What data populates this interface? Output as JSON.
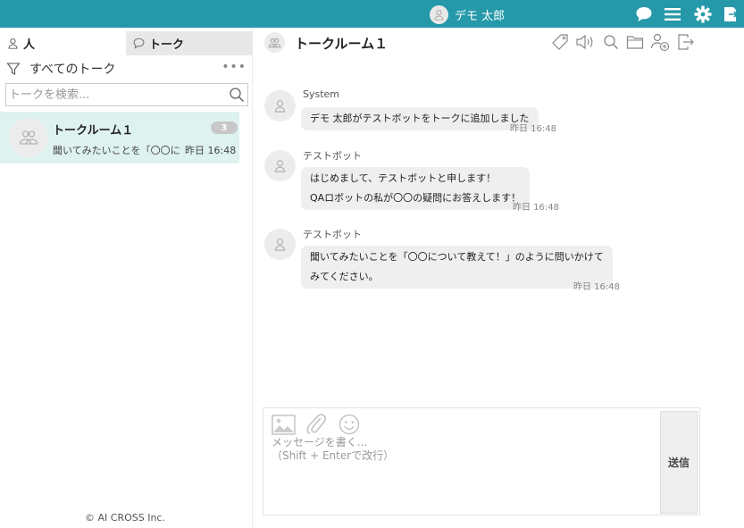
{
  "colors": {
    "topbar": "#2599a9",
    "room_selected_bg": "#def2f0",
    "bubble_bg": "#efefef"
  },
  "topbar": {
    "user_name": "デモ 太郎",
    "icons": [
      "chat-icon",
      "menu-icon",
      "gear-icon",
      "logout-icon"
    ]
  },
  "left": {
    "tabs": [
      {
        "label": "人",
        "icon": "person-icon"
      },
      {
        "label": "トーク",
        "icon": "speech-bubble-icon"
      }
    ],
    "filter_label": "すべてのトーク",
    "more_label": "•••",
    "search_placeholder": "トークを検索...",
    "rooms": [
      {
        "name": "トークルーム１",
        "unread": "3",
        "preview": "聞いてみたいことを「〇〇について",
        "time": "昨日 16:48"
      }
    ],
    "copyright": "© AI CROSS Inc."
  },
  "chat": {
    "title": "トークルーム１",
    "header_icons": [
      "tag-icon",
      "speaker-icon",
      "search-icon",
      "folder-icon",
      "add-member-icon",
      "leave-room-icon"
    ],
    "messages": [
      {
        "sender": "System",
        "lines": [
          "デモ 太郎がテストボットをトークに追加しました"
        ],
        "time": "昨日 16:48"
      },
      {
        "sender": "テストボット",
        "lines": [
          "はじめまして、テストボットと申します！",
          "QAロボットの私が〇〇の疑問にお答えします！"
        ],
        "time": "昨日 16:48"
      },
      {
        "sender": "テストボット",
        "lines": [
          "聞いてみたいことを「〇〇について教えて！」のように問いかけて",
          "みてください。"
        ],
        "time": "昨日 16:48"
      }
    ]
  },
  "composer": {
    "placeholder": "メッセージを書く...\n（Shift + Enterで改行）",
    "tools": [
      "image-icon",
      "attachment-icon",
      "emoji-icon"
    ],
    "send_label": "送信"
  }
}
